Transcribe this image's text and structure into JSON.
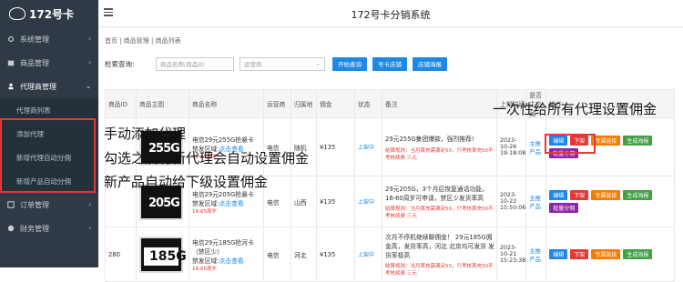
{
  "sidebar": {
    "logo": "172号卡",
    "items": [
      {
        "label": "系统管理",
        "arrow": "‹"
      },
      {
        "label": "商品管理",
        "arrow": "‹"
      },
      {
        "label": "代理商管理",
        "arrow": "⌄"
      },
      {
        "label": "订单管理",
        "arrow": "‹"
      },
      {
        "label": "财务管理",
        "arrow": "‹"
      }
    ],
    "subitems": [
      "代理商列表",
      "添加代理",
      "新增代理自动分佣",
      "新增产品自动分佣"
    ]
  },
  "header": {
    "title": "172号卡分销系统"
  },
  "breadcrumb": "首页 | 商品管理 | 商品列表",
  "filter": {
    "label": "检索查询:",
    "name_placeholder": "商品名称/商品ID",
    "operator_placeholder": "运营商",
    "search_btn": "开始查询",
    "shop_btn": "号卡店铺",
    "poster_btn": "店铺海报"
  },
  "table": {
    "headers": [
      "商品ID",
      "商品主图",
      "商品名称",
      "运营商",
      "归属地",
      "佣金",
      "状态",
      "备注",
      "上架时间",
      "是否主产品",
      "操作"
    ],
    "rows": [
      {
        "id": "",
        "thumb": "255G",
        "name": "电信29元255G抢悬卡",
        "restrict_label": "禁发区域:",
        "restrict_link": "点击查看",
        "age": "18-65周岁",
        "operator": "电信",
        "region": "随机",
        "commission": "¥135",
        "status": "上架中",
        "note": "29元255G集团爆款，强烈推荐!",
        "note_red": "结算规则：当月首充需满足50，只考核首充50不考核续费 三元",
        "time": "2023-10-26 19:18:08",
        "main": "主推产品"
      },
      {
        "id": "",
        "thumb": "205G",
        "name": "电信29元205G抢悬卡",
        "restrict_label": "禁发区域:",
        "restrict_link": "点击查看",
        "age": "18-65周岁",
        "operator": "电信",
        "region": "山西",
        "commission": "¥135",
        "status": "上架中",
        "note": "29元205G，3个月后恢复通话功能，16-60周岁可申请，禁区少发货率高",
        "note_red": "结算规则：当月首充需满足50，只考核首充50不考核续费 三元",
        "time": "2023-10-22 15:50:06",
        "main": "主推产品"
      },
      {
        "id": "280",
        "thumb": "185G",
        "name": "电信29元185G抢河卡（禁区少）",
        "restrict_label": "禁发区域:",
        "restrict_link": "点击查看",
        "age": "18-65周岁",
        "operator": "电信",
        "region": "河北",
        "commission": "¥135",
        "status": "上架中",
        "note": "次月不停机继续聊佣金！ 29元185G佣金高，发货率高，河北 北京均可发货 发货率极高",
        "note_red": "结算规则：当月首充需满足50，只考核首充50不考核续费 三元",
        "time": "2023-10-21 15:23:38",
        "main": "主推产品"
      }
    ],
    "ops": [
      "编辑",
      "下架",
      "专属链接",
      "生成海报",
      "批量分佣"
    ]
  },
  "annotations": {
    "a1": "一次性给所有代理设置佣金",
    "a2": "手动添加代理",
    "a3": "勾选之后有新代理会自动设置佣金",
    "a4": "新产品自动给下级设置佣金"
  },
  "colors": {
    "sidebar": "#2f3a46",
    "primary": "#1e88e5",
    "danger": "#e53935",
    "orange": "#f57c00",
    "green": "#43a047",
    "purple": "#8e24aa"
  }
}
